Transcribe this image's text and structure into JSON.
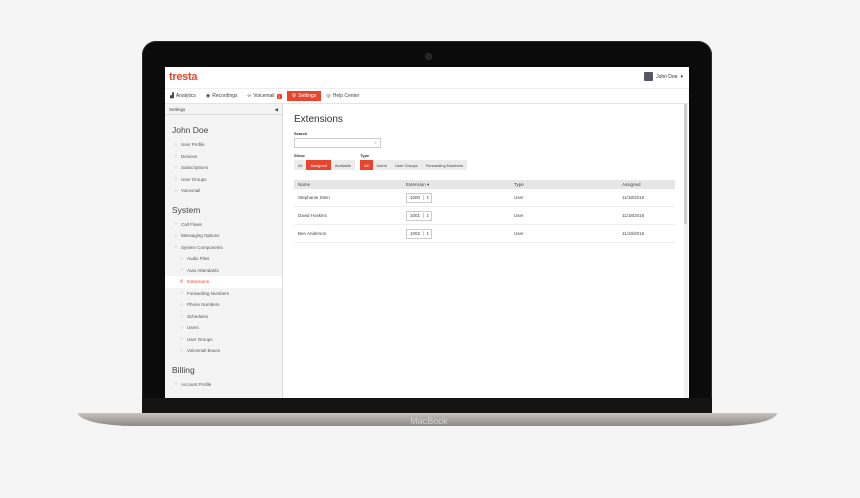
{
  "app": {
    "logo": "tresta",
    "user_name": "John Doe"
  },
  "device": {
    "brand_label": "MacBook"
  },
  "nav": [
    {
      "label": "Analytics",
      "icon": "chart-icon"
    },
    {
      "label": "Recordings",
      "icon": "recordings-icon"
    },
    {
      "label": "Voicemail",
      "icon": "voicemail-icon",
      "badge": "1"
    },
    {
      "label": "Settings",
      "icon": "gear-icon",
      "active": true
    },
    {
      "label": "Help Center",
      "icon": "help-icon"
    }
  ],
  "sidebar": {
    "header": "Settings",
    "sections": [
      {
        "title": "John Doe",
        "items": [
          {
            "label": "User Profile"
          },
          {
            "label": "Devices"
          },
          {
            "label": "Subscriptions"
          },
          {
            "label": "User Groups"
          },
          {
            "label": "Voicemail"
          }
        ]
      },
      {
        "title": "System",
        "items": [
          {
            "label": "Call Flows"
          },
          {
            "label": "Messaging Options"
          },
          {
            "label": "System Components"
          },
          {
            "label": "Audio Files",
            "sub": true
          },
          {
            "label": "Auto Attendants",
            "sub": true
          },
          {
            "label": "Extensions",
            "sub": true,
            "active": true
          },
          {
            "label": "Forwarding Numbers",
            "sub": true
          },
          {
            "label": "Phone Numbers",
            "sub": true
          },
          {
            "label": "Schedules",
            "sub": true
          },
          {
            "label": "Users",
            "sub": true
          },
          {
            "label": "User Groups",
            "sub": true
          },
          {
            "label": "Voicemail Boxes",
            "sub": true
          }
        ]
      },
      {
        "title": "Billing",
        "items": [
          {
            "label": "Account Profile"
          }
        ]
      }
    ]
  },
  "main": {
    "title": "Extensions",
    "search_label": "Search",
    "search_placeholder": "",
    "show_label": "Show",
    "show_options": [
      {
        "label": "All"
      },
      {
        "label": "Assigned",
        "on": true
      },
      {
        "label": "Available"
      }
    ],
    "type_label": "Type",
    "type_options": [
      {
        "label": "All",
        "on": true
      },
      {
        "label": "Users"
      },
      {
        "label": "User Groups"
      },
      {
        "label": "Forwarding Numbers"
      }
    ],
    "columns": [
      "Name",
      "Extension ▾",
      "Type",
      "Assigned"
    ],
    "rows": [
      {
        "name": "Stephanie Stein",
        "extension": "1000",
        "type": "User",
        "assigned": "11/18/2016"
      },
      {
        "name": "David Hoskins",
        "extension": "1001",
        "type": "User",
        "assigned": "11/18/2016"
      },
      {
        "name": "Ben Anderson",
        "extension": "1002",
        "type": "User",
        "assigned": "11/18/2016"
      }
    ]
  },
  "colors": {
    "accent": "#e8452e",
    "sidebar_bg": "#f4f4f4"
  }
}
